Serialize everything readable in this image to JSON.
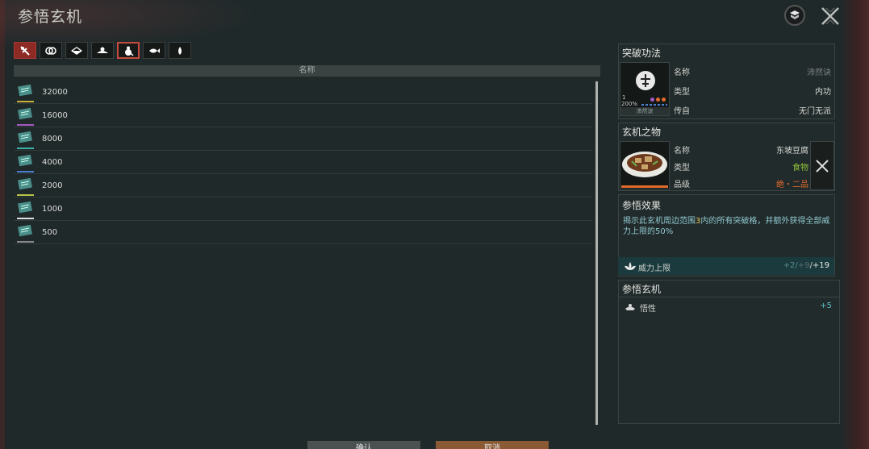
{
  "window": {
    "title": "参悟玄机"
  },
  "filters": {
    "tabs": [
      {
        "icon": "sword-fist-icon",
        "active": true
      },
      {
        "icon": "rings-icon",
        "active": false
      },
      {
        "icon": "scroll-book-icon",
        "active": false
      },
      {
        "icon": "hand-lotus-icon",
        "active": false
      },
      {
        "icon": "gourd-bag-icon",
        "active": false,
        "hover": true
      },
      {
        "icon": "fish-icon",
        "active": false
      },
      {
        "icon": "drop-icon",
        "active": false
      }
    ]
  },
  "list": {
    "header": "名称",
    "items": [
      {
        "value": "32000",
        "bar_color": "#c9b03a"
      },
      {
        "value": "16000",
        "bar_color": "#a45ac0"
      },
      {
        "value": "8000",
        "bar_color": "#3fb2a8"
      },
      {
        "value": "4000",
        "bar_color": "#4a7fd0"
      },
      {
        "value": "2000",
        "bar_color": "#b8c24a"
      },
      {
        "value": "1000",
        "bar_color": "#e0e0e0"
      },
      {
        "value": "500",
        "bar_color": "#8a8a8a"
      }
    ]
  },
  "breakthrough": {
    "title": "突破功法",
    "thumb_name": "沛然诀",
    "thumb_percent": "200%",
    "thumb_level": "1",
    "name_label": "名称",
    "name_value": "沛然诀",
    "type_label": "类型",
    "type_value": "内功",
    "origin_label": "传自",
    "origin_value": "无门无派"
  },
  "item": {
    "title": "玄机之物",
    "name_label": "名称",
    "name_value": "东坡豆腐",
    "type_label": "类型",
    "type_value": "食物",
    "grade_label": "品级",
    "grade_value": "绝・二品"
  },
  "effect": {
    "title": "参悟效果",
    "text_before": "揭示此玄机周边范围",
    "text_highlight": "3",
    "text_after": "内的所有突破格，并额外获得全部威力上限的50%",
    "power_label": "威力上限",
    "power_a": "+2",
    "power_b": "+9",
    "power_c": "+19"
  },
  "insight": {
    "title": "参悟玄机",
    "stat_label": "悟性",
    "stat_value": "+5"
  },
  "buttons": {
    "confirm": "确认",
    "cancel": "取消"
  },
  "colors": {
    "accent_red": "#8e2a24",
    "grade_orange": "#e36a2a",
    "food_green": "#8fc23a",
    "effect_text": "#8ec7cf"
  }
}
